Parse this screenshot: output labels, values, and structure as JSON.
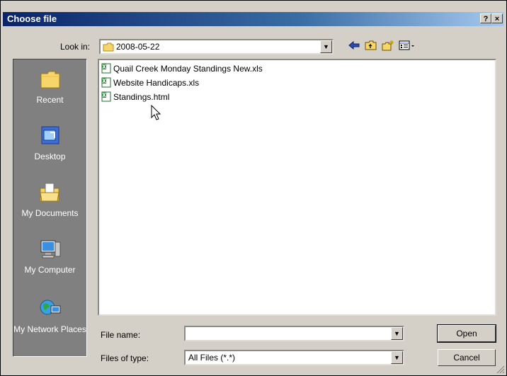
{
  "dialog": {
    "title": "Choose file",
    "help_label": "?",
    "close_label": "×"
  },
  "lookin": {
    "label": "Look in:",
    "value": "2008-05-22"
  },
  "toolbar": {
    "back_icon": "back-arrow-icon",
    "up_icon": "up-folder-icon",
    "new_folder_icon": "new-folder-icon",
    "view_menu_icon": "view-menu-icon"
  },
  "places": [
    {
      "label": "Recent",
      "icon": "recent-folder-icon"
    },
    {
      "label": "Desktop",
      "icon": "desktop-icon"
    },
    {
      "label": "My Documents",
      "icon": "my-documents-icon"
    },
    {
      "label": "My Computer",
      "icon": "my-computer-icon"
    },
    {
      "label": "My Network Places",
      "icon": "network-places-icon"
    }
  ],
  "files": [
    {
      "name": "Quail Creek Monday Standings New.xls",
      "icon": "excel-file-icon"
    },
    {
      "name": "Website Handicaps.xls",
      "icon": "excel-file-icon"
    },
    {
      "name": "Standings.html",
      "icon": "excel-file-icon"
    }
  ],
  "filename": {
    "label": "File name:",
    "value": ""
  },
  "filetype": {
    "label": "Files of type:",
    "value": "All Files (*.*)"
  },
  "buttons": {
    "open": "Open",
    "cancel": "Cancel"
  },
  "colors": {
    "titlebar": "#0a246a",
    "face": "#d4d0c8",
    "places_bg": "#808080"
  }
}
